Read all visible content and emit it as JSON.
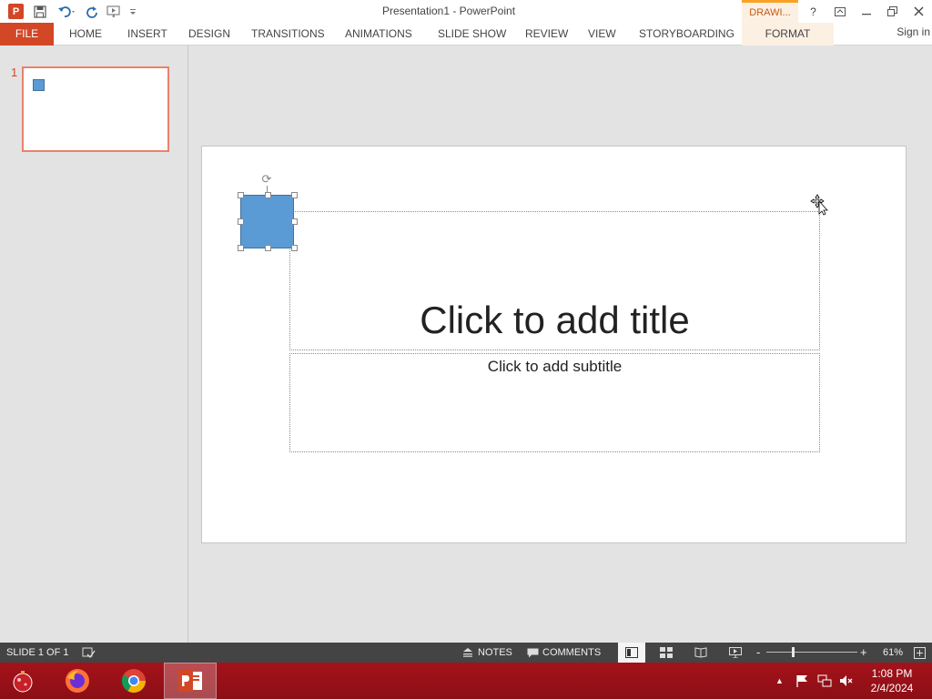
{
  "window": {
    "title": "Presentation1 - PowerPoint",
    "contextual_tab_group": "DRAWI...",
    "help": "?"
  },
  "ribbon": {
    "tabs": [
      {
        "label": "FILE"
      },
      {
        "label": "HOME"
      },
      {
        "label": "INSERT"
      },
      {
        "label": "DESIGN"
      },
      {
        "label": "TRANSITIONS"
      },
      {
        "label": "ANIMATIONS"
      },
      {
        "label": "SLIDE SHOW"
      },
      {
        "label": "REVIEW"
      },
      {
        "label": "VIEW"
      },
      {
        "label": "STORYBOARDING"
      },
      {
        "label": "FORMAT"
      }
    ],
    "sign_in": "Sign in"
  },
  "thumbnails": [
    {
      "number": "1"
    }
  ],
  "slide": {
    "title_placeholder": "Click to add title",
    "subtitle_placeholder": "Click to add subtitle"
  },
  "status_bar": {
    "slide_info": "SLIDE 1 OF 1",
    "notes": "NOTES",
    "comments": "COMMENTS",
    "zoom": "61%",
    "zoom_minus": "-",
    "zoom_plus": "+"
  },
  "taskbar": {
    "time": "1:08 PM",
    "date": "2/4/2024"
  },
  "colors": {
    "accent": "#d24726",
    "shape_fill": "#5b9bd5",
    "taskbar": "#a4121a"
  }
}
